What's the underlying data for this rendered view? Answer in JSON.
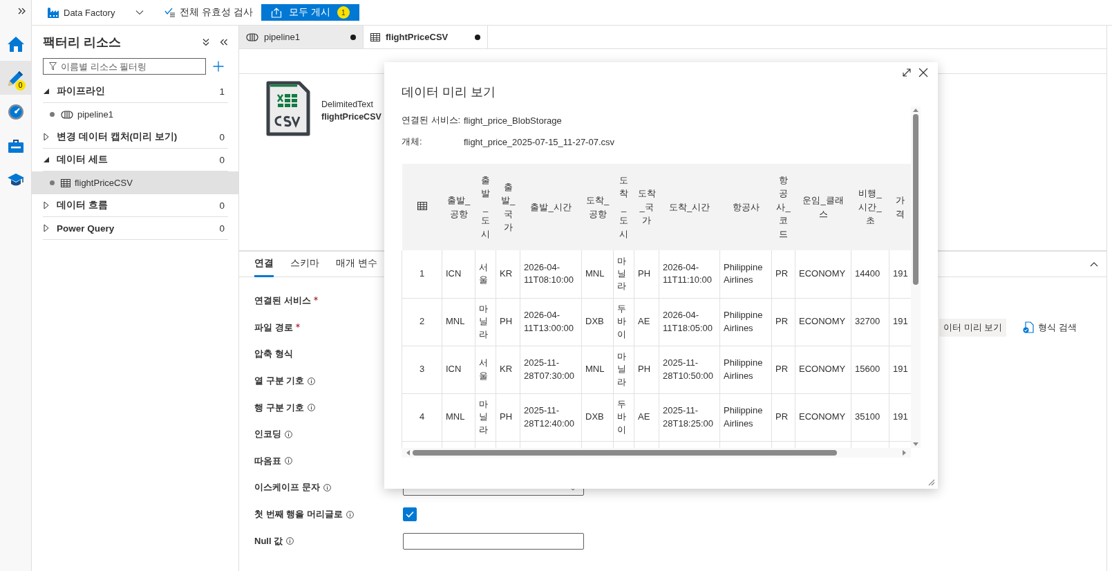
{
  "rail": {
    "items": [
      {
        "kind": "home",
        "selected": false
      },
      {
        "kind": "author",
        "selected": true,
        "badge": "0"
      },
      {
        "kind": "monitor",
        "selected": false
      },
      {
        "kind": "manage",
        "selected": false
      },
      {
        "kind": "learn",
        "selected": false
      }
    ]
  },
  "toolbar": {
    "factory": "Data Factory",
    "validate_all": "전체 유효성 검사",
    "publish": {
      "label": "모두 게시",
      "badge": "1"
    }
  },
  "resources": {
    "title": "팩터리 리소스",
    "filter": {
      "placeholder": "이름별 리소스 필터링"
    },
    "sections": [
      {
        "label": "파이프라인",
        "count": "1",
        "expanded": true,
        "children": [
          {
            "label": "pipeline1",
            "kind": "pipeline",
            "selected": false
          }
        ]
      },
      {
        "label": "변경 데이터 캡처(미리 보기)",
        "count": "0",
        "expanded": false
      },
      {
        "label": "데이터 세트",
        "count": "0",
        "expanded": true,
        "children": [
          {
            "label": "flightPriceCSV",
            "kind": "dataset",
            "selected": true
          }
        ]
      },
      {
        "label": "데이터 흐름",
        "count": "0",
        "expanded": false
      },
      {
        "label": "Power Query",
        "count": "0",
        "expanded": false
      }
    ]
  },
  "editor_tabs": [
    {
      "label": "pipeline1",
      "kind": "pipeline",
      "selected": false,
      "unsaved": true
    },
    {
      "label": "flightPriceCSV",
      "kind": "dataset",
      "selected": true,
      "unsaved": true
    }
  ],
  "dataset": {
    "type": "DelimitedText",
    "name": "flightPriceCSV"
  },
  "properties": {
    "tabs": [
      {
        "label": "연결",
        "selected": true
      },
      {
        "label": "스키마",
        "selected": false
      },
      {
        "label": "매개 변수",
        "selected": false
      }
    ],
    "fields": [
      {
        "label": "연결된 서비스",
        "required": true,
        "info": false
      },
      {
        "label": "파일 경로",
        "required": true,
        "info": false,
        "actions": [
          {
            "label": "이터 미리 보기",
            "kind": "preview"
          },
          {
            "label": "형식 검색",
            "kind": "detect"
          }
        ]
      },
      {
        "label": "압축 형식",
        "required": false,
        "info": false
      },
      {
        "label": "열 구분 기호",
        "required": false,
        "info": true
      },
      {
        "label": "행 구분 기호",
        "required": false,
        "info": true
      },
      {
        "label": "인코딩",
        "required": false,
        "info": true
      },
      {
        "label": "따옴표",
        "required": false,
        "info": true
      },
      {
        "label": "이스케이프 문자",
        "required": false,
        "info": true,
        "kind": "dropdown"
      },
      {
        "label": "첫 번째 행을 머리글로",
        "required": false,
        "info": true,
        "kind": "checkbox",
        "checked": true
      },
      {
        "label": "Null 값",
        "required": false,
        "info": true,
        "kind": "text"
      }
    ]
  },
  "preview_dialog": {
    "title": "데이터 미리 보기",
    "details": [
      {
        "label": "연결된 서비스:",
        "value": "flight_price_BlobStorage"
      },
      {
        "label": "개체:",
        "value": "flight_price_2025-07-15_11-27-07.csv"
      }
    ],
    "table": {
      "columns": [
        "",
        "출발_공항",
        "출발_도시",
        "출발_국가",
        "출발_시간",
        "도착_공항",
        "도착_도시",
        "도착_국가",
        "도착_시간",
        "항공사",
        "항공사_코드",
        "운임_클래스",
        "비행_시간_초",
        "가격"
      ],
      "rows": [
        {
          "cells": [
            "1",
            "ICN",
            "서울",
            "KR",
            "2026-04-11T08:10:00",
            "MNL",
            "마닐라",
            "PH",
            "2026-04-11T11:10:00",
            "Philippine Airlines",
            "PR",
            "ECONOMY",
            "14400",
            "191"
          ]
        },
        {
          "cells": [
            "2",
            "MNL",
            "마닐라",
            "PH",
            "2026-04-11T13:00:00",
            "DXB",
            "두바이",
            "AE",
            "2026-04-11T18:05:00",
            "Philippine Airlines",
            "PR",
            "ECONOMY",
            "32700",
            "191"
          ]
        },
        {
          "cells": [
            "3",
            "ICN",
            "서울",
            "KR",
            "2025-11-28T07:30:00",
            "MNL",
            "마닐라",
            "PH",
            "2025-11-28T10:50:00",
            "Philippine Airlines",
            "PR",
            "ECONOMY",
            "15600",
            "191"
          ]
        },
        {
          "cells": [
            "4",
            "MNL",
            "마닐라",
            "PH",
            "2025-11-28T12:40:00",
            "DXB",
            "두바이",
            "AE",
            "2025-11-28T18:25:00",
            "Philippine Airlines",
            "PR",
            "ECONOMY",
            "35100",
            "191"
          ]
        }
      ]
    }
  }
}
